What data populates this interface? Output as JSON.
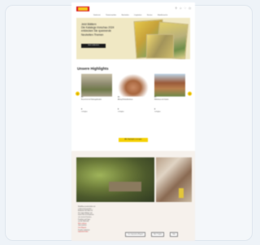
{
  "nav": {
    "links": [
      "Sortiment",
      "Themenwelten",
      "Neuheiten",
      "Inspiration",
      "Service",
      "Händlersuche",
      "Über uns"
    ],
    "icons": [
      "search-icon",
      "user-icon",
      "heart-icon",
      "cart-icon"
    ]
  },
  "hero": {
    "lines": [
      "Jetzt Blättern",
      "Die Katalogs-Vorschau 2024",
      "entdecken Sie spannende",
      "Neuheiten-Themen"
    ],
    "button_label": "Jetzt entdecken"
  },
  "highlights": {
    "title": "Unsere Highlights",
    "products": [
      {
        "code": "Art.",
        "name": "Bauernhof mit Nebengebäuden",
        "price": "€",
        "availability": "verfügbar"
      },
      {
        "code": "Art.",
        "name": "Abtrag Einfamilienhaus",
        "price": "€",
        "availability": "verfügbar"
      },
      {
        "code": "Art.",
        "name": "Wohnhaus mit Garten",
        "price": "€",
        "availability": "verfügbar"
      }
    ],
    "cta_label": "Alle Highlights anzeigen"
  },
  "feature": {
    "text_lines": [
      "Modellbau-Landschaften mit",
      "Leidenschaft gestaltet —",
      "Entdecken Sie Ideen für",
      "Ihre eigene Anlage und",
      "lassen Sie sich inspirieren",
      "von unseren Diorama-",
      "Projekten und Tipps",
      "aus der Werkstatt.",
      "Mehr erfahren",
      "Jetzt ansehen",
      "Zum Magazin",
      "Projekte entdecken",
      "Inspiration holen"
    ],
    "red_indices": [
      8,
      10,
      12
    ],
    "buttons": [
      "Zum Inspirations-Magazin",
      "Mehr Projekte",
      "Video"
    ]
  }
}
